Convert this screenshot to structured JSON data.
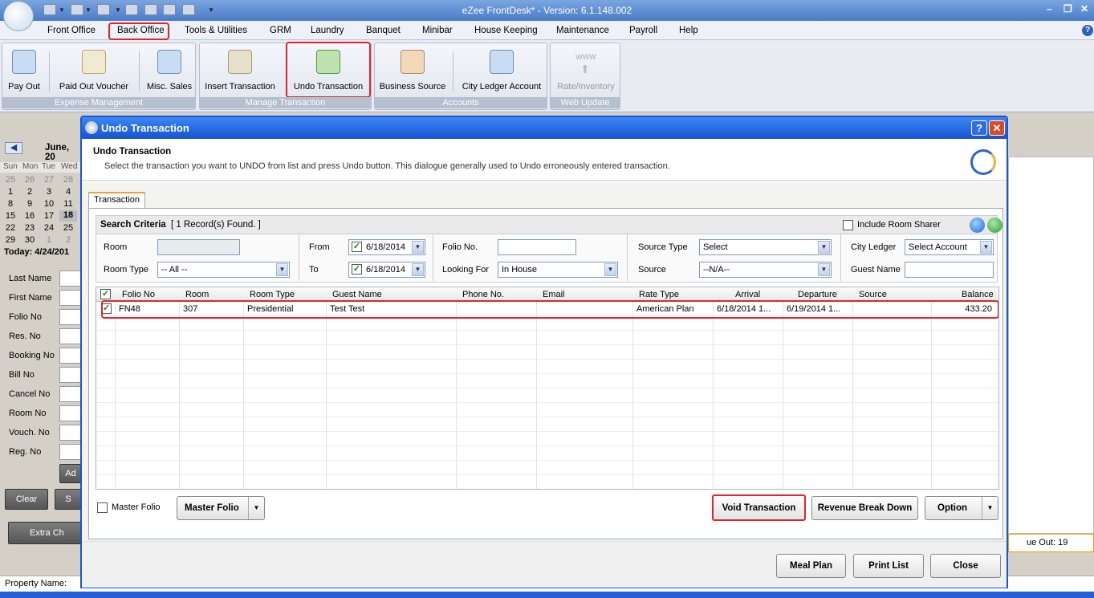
{
  "app": {
    "title": "eZee FrontDesk* - Version: 6.1.148.002"
  },
  "menu": [
    "Front Office",
    "Back Office",
    "Tools & Utilities",
    "GRM",
    "Laundry",
    "Banquet",
    "Minibar",
    "House Keeping",
    "Maintenance",
    "Payroll",
    "Help"
  ],
  "ribbon": {
    "groups": [
      "Expense Management",
      "Manage Transaction",
      "Accounts",
      "Web Update"
    ],
    "buttons": [
      "Pay Out",
      "Paid Out Voucher",
      "Misc. Sales",
      "Insert Transaction",
      "Undo Transaction",
      "Business Source",
      "City Ledger Account",
      "WWW",
      "Rate/Inventory"
    ]
  },
  "calendar": {
    "month": "June, 20",
    "days": [
      "Sun",
      "Mon",
      "Tue",
      "Wed"
    ],
    "rows": [
      [
        "25",
        "26",
        "27",
        "28"
      ],
      [
        "1",
        "2",
        "3",
        "4"
      ],
      [
        "8",
        "9",
        "10",
        "11"
      ],
      [
        "15",
        "16",
        "17",
        "18"
      ],
      [
        "22",
        "23",
        "24",
        "25"
      ],
      [
        "29",
        "30",
        "1",
        "2"
      ]
    ],
    "today": "Today: 4/24/201"
  },
  "left_panel": {
    "fields": [
      "Last Name",
      "First Name",
      "Folio No",
      "Res. No",
      "Booking No",
      "Bill No",
      "Cancel No",
      "Room No",
      "Vouch. No",
      "Reg. No"
    ],
    "add_label": "Ad",
    "clear_label": "Clear",
    "s_label": "S",
    "extra_label": "Extra Ch"
  },
  "right_status": "ue Out: 19",
  "statusbar": {
    "property_label": "Property Name:"
  },
  "dialog": {
    "title": "Undo Transaction",
    "heading": "Undo Transaction",
    "description": "Select the transaction you want to UNDO from list and press Undo button. This dialogue generally used to Undo erroneously entered transaction.",
    "tab": "Transaction",
    "search": {
      "title": "Search Criteria",
      "count": "[ 1 Record(s) Found. ]",
      "include_sharer": "Include Room Sharer",
      "room_label": "Room",
      "room_value": "",
      "room_type_label": "Room Type",
      "room_type_value": "-- All --",
      "from_label": "From",
      "from_value": "6/18/2014",
      "to_label": "To",
      "to_value": "6/18/2014",
      "folio_label": "Folio No.",
      "folio_value": "",
      "looking_label": "Looking For",
      "looking_value": "In House",
      "source_type_label": "Source Type",
      "source_type_value": "Select",
      "source_label": "Source",
      "source_value": "--N/A--",
      "city_ledger_label": "City Ledger",
      "city_ledger_value": "Select Account",
      "guest_label": "Guest Name",
      "guest_value": ""
    },
    "columns": [
      "Folio No",
      "Room",
      "Room Type",
      "Guest Name",
      "Phone No.",
      "Email",
      "Rate Type",
      "Arrival",
      "Departure",
      "Source",
      "Balance"
    ],
    "rows": [
      {
        "folio": "FN48",
        "room": "307",
        "room_type": "Presidential",
        "guest": "Test Test",
        "phone": "",
        "email": "",
        "rate_type": "American Plan",
        "arrival": "6/18/2014 1...",
        "departure": "6/19/2014 1...",
        "source": "",
        "balance": "433.20"
      }
    ],
    "master_folio_check": "Master Folio",
    "master_folio_value": "Master Folio",
    "buttons": {
      "void": "Void Transaction",
      "revenue": "Revenue Break Down",
      "option": "Option",
      "meal": "Meal Plan",
      "print": "Print List",
      "close": "Close"
    }
  }
}
